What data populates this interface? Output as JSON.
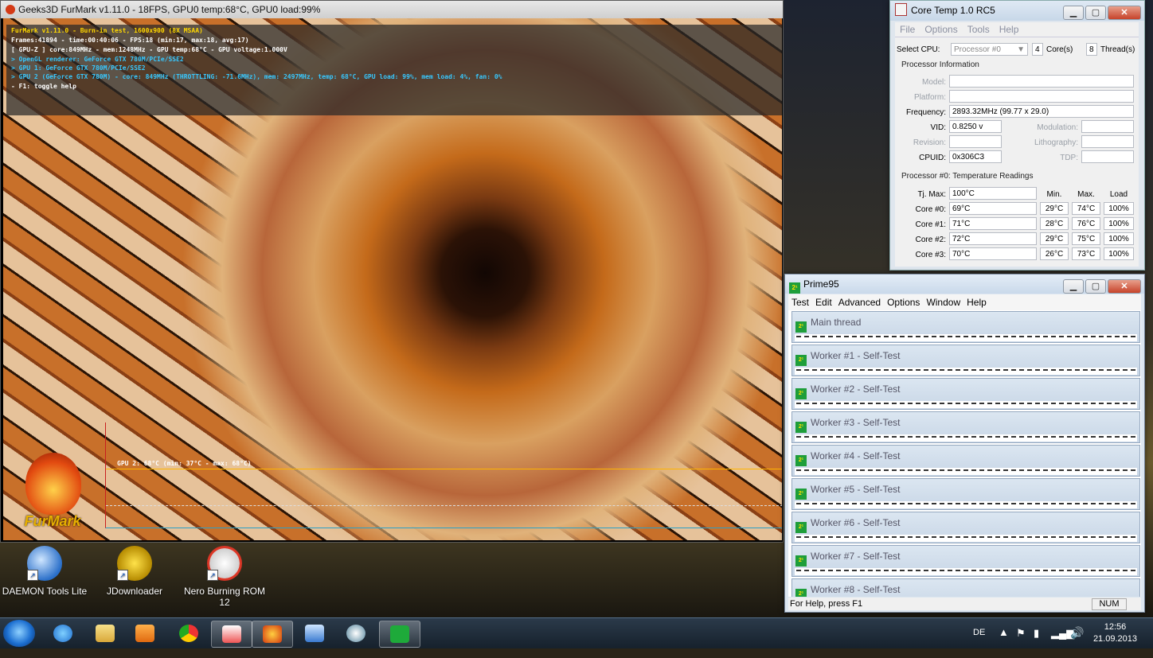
{
  "furmark": {
    "title": "Geeks3D FurMark v1.11.0 - 18FPS, GPU0 temp:68°C, GPU0 load:99%",
    "overlay": [
      "FurMark v1.11.0 - Burn-in test, 1600x900 (8X MSAA)",
      "Frames:41894 - time:00:40:06 - FPS:18 (min:17, max:18, avg:17)",
      "[ GPU-Z ] core:849MHz - mem:1248MHz - GPU temp:68°C - GPU voltage:1.000V",
      "> OpenGL renderer: GeForce GTX 780M/PCIe/SSE2",
      "> GPU 1: GeForce GTX 780M/PCIe/SSE2",
      "> GPU 2 (GeForce GTX 780M) - core: 849MHz (THROTTLING: -71.6MHz), mem: 2497MHz, temp: 68°C, GPU load: 99%, mem load: 4%, fan: 0%",
      "- F1: toggle help"
    ],
    "graph_label": "GPU 2: 68°C (min: 37°C - max: 68°C)",
    "logo_text": "FurMark"
  },
  "desktop_icons": [
    {
      "label": "DAEMON Tools Lite",
      "icon": "daemon-tools-icon"
    },
    {
      "label": "JDownloader",
      "icon": "jdownloader-icon"
    },
    {
      "label": "Nero Burning ROM 12",
      "icon": "nero-icon"
    }
  ],
  "coretemp": {
    "title": "Core Temp 1.0 RC5",
    "menu": [
      "File",
      "Options",
      "Tools",
      "Help"
    ],
    "select_cpu_label": "Select CPU:",
    "select_cpu_value": "Processor #0",
    "cores_value": "4",
    "cores_label": "Core(s)",
    "threads_value": "8",
    "threads_label": "Thread(s)",
    "processor_info_title": "Processor Information",
    "model_label": "Model:",
    "model_value": "",
    "platform_label": "Platform:",
    "platform_value": "",
    "frequency_label": "Frequency:",
    "frequency_value": "2893.32MHz (99.77 x 29.0)",
    "vid_label": "VID:",
    "vid_value": "0.8250 v",
    "modulation_label": "Modulation:",
    "modulation_value": "",
    "revision_label": "Revision:",
    "revision_value": "",
    "lithography_label": "Lithography:",
    "lithography_value": "",
    "cpuid_label": "CPUID:",
    "cpuid_value": "0x306C3",
    "tdp_label": "TDP:",
    "tdp_value": "",
    "temp_title": "Processor #0: Temperature Readings",
    "tjmax_label": "Tj. Max:",
    "tjmax_value": "100°C",
    "col_min": "Min.",
    "col_max": "Max.",
    "col_load": "Load",
    "cores": [
      {
        "label": "Core #0:",
        "temp": "69°C",
        "min": "29°C",
        "max": "74°C",
        "load": "100%"
      },
      {
        "label": "Core #1:",
        "temp": "71°C",
        "min": "28°C",
        "max": "76°C",
        "load": "100%"
      },
      {
        "label": "Core #2:",
        "temp": "72°C",
        "min": "29°C",
        "max": "75°C",
        "load": "100%"
      },
      {
        "label": "Core #3:",
        "temp": "70°C",
        "min": "26°C",
        "max": "73°C",
        "load": "100%"
      }
    ]
  },
  "prime95": {
    "title": "Prime95",
    "menu": [
      "Test",
      "Edit",
      "Advanced",
      "Options",
      "Window",
      "Help"
    ],
    "windows": [
      "Main thread",
      "Worker #1 - Self-Test",
      "Worker #2 - Self-Test",
      "Worker #3 - Self-Test",
      "Worker #4 - Self-Test",
      "Worker #5 - Self-Test",
      "Worker #6 - Self-Test",
      "Worker #7 - Self-Test",
      "Worker #8 - Self-Test"
    ],
    "status_text": "For Help, press F1",
    "status_num": "NUM"
  },
  "taskbar": {
    "language": "DE",
    "time": "12:56",
    "date": "21.09.2013"
  }
}
